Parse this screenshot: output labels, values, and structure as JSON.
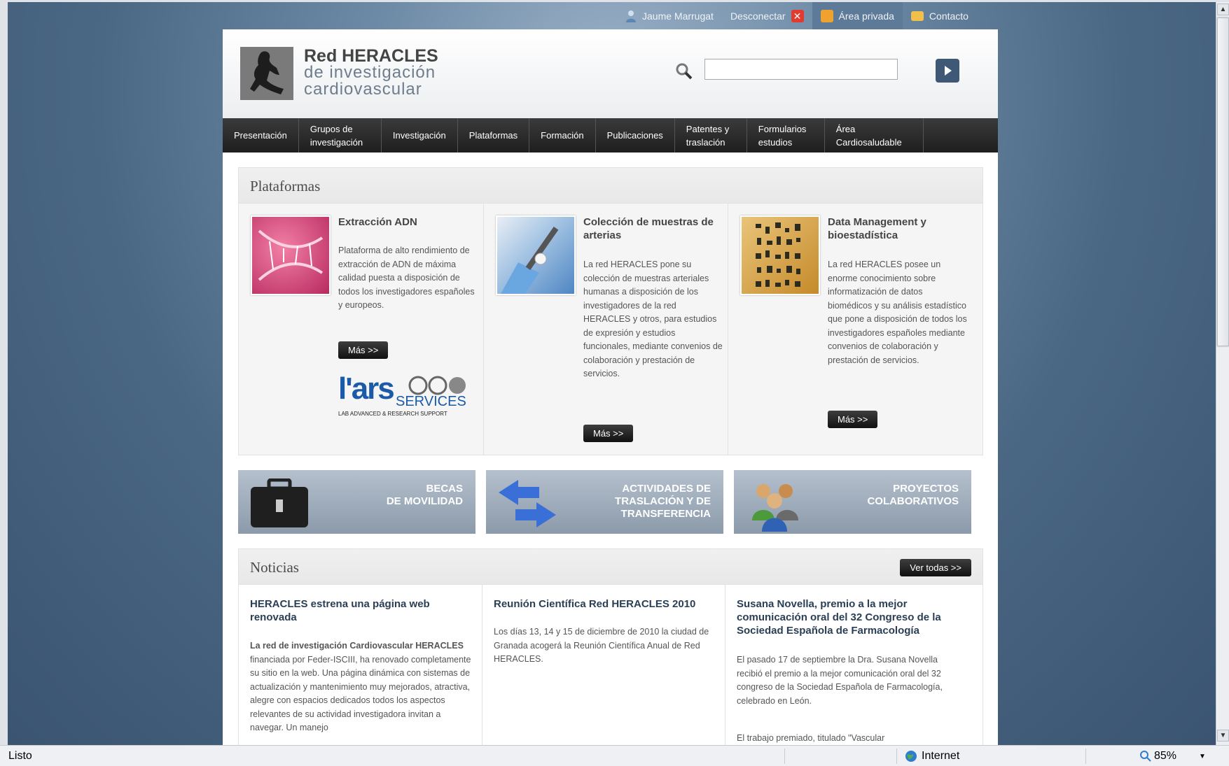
{
  "browser": {
    "status_text": "Listo",
    "zone_label": "Internet",
    "zoom_level": "85%"
  },
  "topbar": {
    "user": "Jaume Marrugat",
    "logout": "Desconectar",
    "private_area": "Área privada",
    "contact": "Contacto"
  },
  "header": {
    "logo_line1": "Red HERACLES",
    "logo_line2": "de investigación",
    "logo_line3": "cardiovascular",
    "search_placeholder": ""
  },
  "nav": {
    "items": [
      {
        "label": "Presentación"
      },
      {
        "label": "Grupos de investigación"
      },
      {
        "label": "Investigación"
      },
      {
        "label": "Plataformas"
      },
      {
        "label": "Formación"
      },
      {
        "label": "Publicaciones"
      },
      {
        "label": "Patentes y traslación"
      },
      {
        "label": "Formularios estudios"
      },
      {
        "label": "Área Cardiosaludable"
      }
    ]
  },
  "plataformas": {
    "title": "Plataformas",
    "items": [
      {
        "title": "Extracción ADN",
        "text": "Plataforma de alto rendimiento de extracción de ADN de máxima calidad puesta a disposición de todos los investigadores españoles y europeos.",
        "more": "Más >>"
      },
      {
        "title": "Colección de muestras de arterias",
        "text": "La red HERACLES pone su colección de muestras arteriales humanas a disposición de los investigadores de la red HERACLES y otros, para estudios de expresión y estudios funcionales, mediante convenios de colaboración y prestación de servicios.",
        "more": "Más >>"
      },
      {
        "title": "Data Management y bioestadística",
        "text": "La red HERACLES posee un enorme conocimiento sobre informatización de datos biomédicos y su análisis estadístico que pone a disposición de todos los investigadores españoles mediante convenios de colaboración y prestación de servicios.",
        "more": "Más >>"
      }
    ],
    "lars_logo": {
      "name": "l'ars",
      "word": "SERVICES",
      "tagline": "LAB ADVANCED & RESEARCH SUPPORT"
    }
  },
  "banners": [
    {
      "line1": "BECAS",
      "line2": "DE MOVILIDAD",
      "line3": ""
    },
    {
      "line1": "ACTIVIDADES DE",
      "line2": "TRASLACIÓN Y DE",
      "line3": "TRANSFERENCIA"
    },
    {
      "line1": "PROYECTOS",
      "line2": "COLABORATIVOS",
      "line3": ""
    }
  ],
  "noticias": {
    "title": "Noticias",
    "see_all": "Ver todas >>",
    "items": [
      {
        "title": "HERACLES estrena una página web renovada",
        "text_bold": "La red de investigación Cardiovascular HERACLES",
        "text": " financiada por Feder-ISCIII, ha renovado completamente su sitio en la web. Una página dinámica con sistemas de actualización y mantenimiento muy mejorados, atractiva, alegre con espacios dedicados todos los aspectos relevantes de su actividad investigadora invitan a navegar. Un manejo"
      },
      {
        "title": "Reunión Científica Red HERACLES 2010",
        "text": "Los días 13, 14 y 15 de diciembre de 2010 la ciudad de Granada acogerá la Reunión Científica Anual de Red HERACLES."
      },
      {
        "title": "Susana Novella, premio a la mejor comunicación oral del 32 Congreso de la Sociedad Española de Farmacología",
        "text": "El pasado 17 de septiembre la Dra. Susana Novella recibió el premio a la mejor comunicación oral del 32 congreso de la Sociedad Española de Farmacología, celebrado en León.",
        "text2": "El trabajo premiado, titulado \"Vascular"
      }
    ]
  }
}
